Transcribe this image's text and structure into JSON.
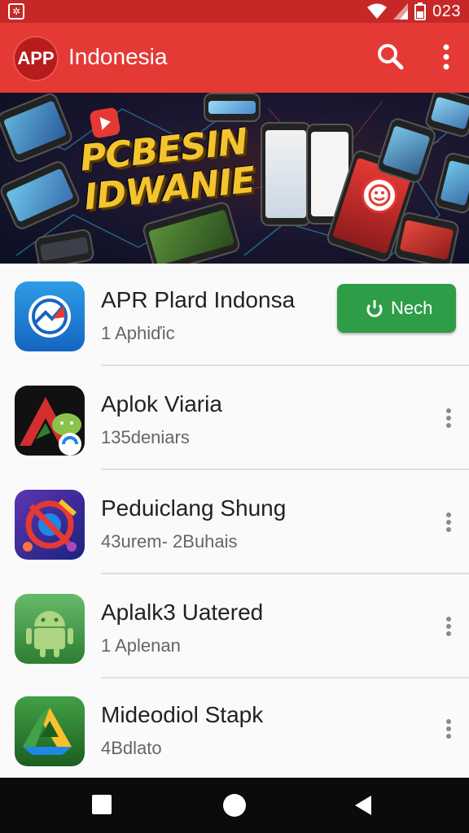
{
  "status_bar": {
    "time": "023",
    "left_icon": "notification-icon",
    "icons": [
      "wifi-icon",
      "signal-icon",
      "battery-icon"
    ]
  },
  "app_bar": {
    "logo_text": "APP",
    "title": "Indonesia",
    "icons": [
      "search-icon",
      "more-vert-icon"
    ]
  },
  "banner": {
    "line1": "PCBESIN",
    "line2": "IDWANIE"
  },
  "apps": [
    {
      "name": "APR Plard Indonsa",
      "subtitle": "1 Aphiďic",
      "action_label": "Nech",
      "icon": "chart-app-icon"
    },
    {
      "name": "Aplok Viaria",
      "subtitle": "135deniars",
      "icon": "android-app-icon"
    },
    {
      "name": "Peduiclang Shung",
      "subtitle": "43urem- 2Buhais",
      "icon": "crossed-app-icon"
    },
    {
      "name": "Aplalk3 Uatered",
      "subtitle": "1 Aplenan",
      "icon": "android-green-icon"
    },
    {
      "name": "Mideodiol Stapk",
      "subtitle": "4Bdlato",
      "icon": "drive-app-icon"
    }
  ],
  "nav_bar": {
    "icons": [
      "recents-icon",
      "home-icon",
      "back-icon"
    ]
  },
  "colors": {
    "primary": "#e53935",
    "status_bar": "#c62828",
    "install_button": "#2e9d47",
    "banner_text": "#f4c430"
  }
}
